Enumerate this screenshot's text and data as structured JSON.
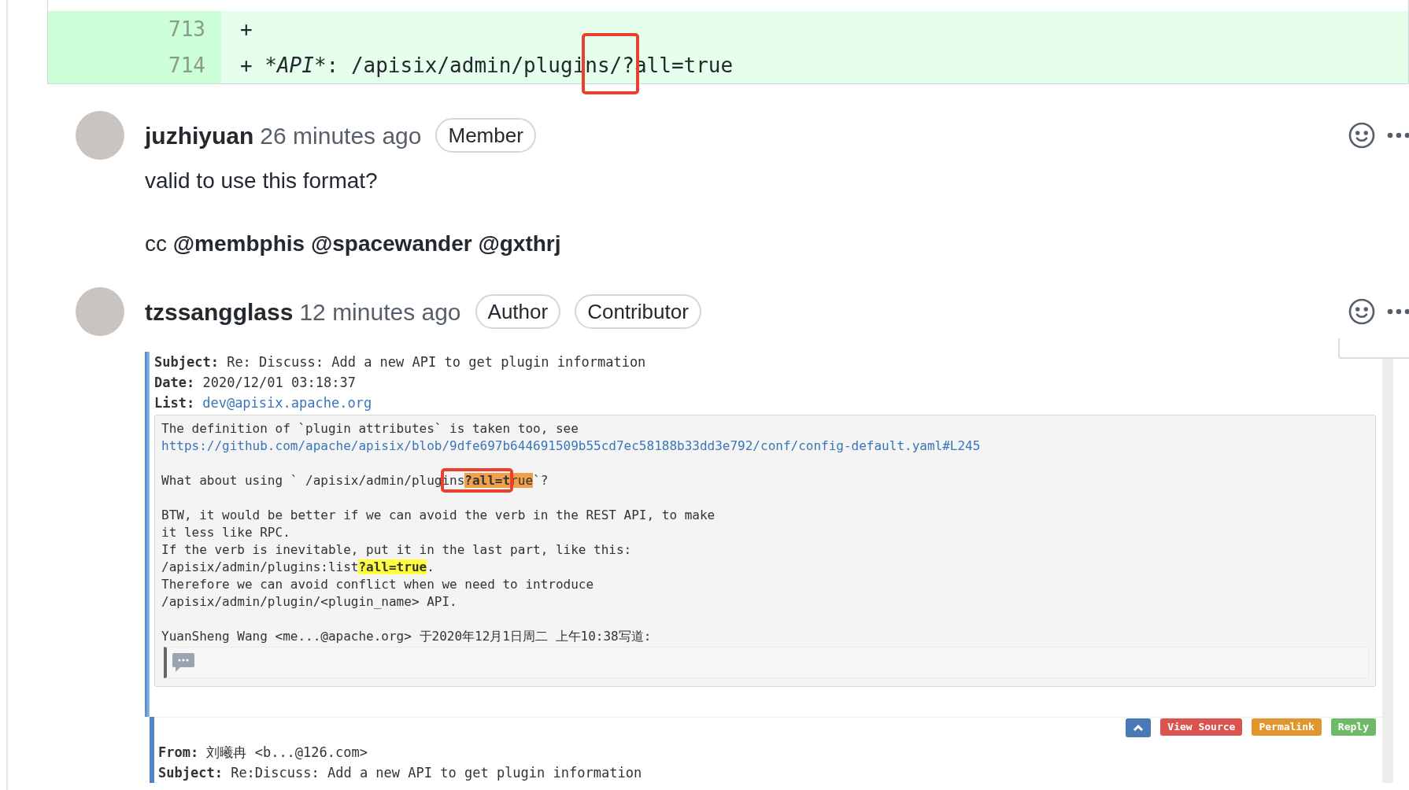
{
  "diff": {
    "lines": [
      {
        "number": "713",
        "kind": "added",
        "segments": [
          {
            "text": "+"
          }
        ]
      },
      {
        "number": "714",
        "kind": "added",
        "segments": [
          {
            "text": "+ *"
          },
          {
            "text": "API",
            "italic": true
          },
          {
            "text": "*: /apisix/admin/plugi"
          },
          {
            "text": "ns/?",
            "marked": true
          },
          {
            "text": "all=true"
          }
        ]
      }
    ]
  },
  "comments": [
    {
      "author": "juzhiyuan",
      "time": "26 minutes ago",
      "badges": [
        "Member"
      ],
      "paragraphs": [
        "valid to use this format?",
        "cc **@membphis** **@spacewander** **@gxthrj**"
      ]
    },
    {
      "author": "tzssangglass",
      "time": "12 minutes ago",
      "badges": [
        "Author",
        "Contributor"
      ],
      "email": {
        "headers": [
          {
            "label": "Subject:",
            "value": "Re: Discuss: Add a new API to get plugin information",
            "kind": "text"
          },
          {
            "label": "Date:",
            "value": "2020/12/01 03:18:37",
            "kind": "text"
          },
          {
            "label": "List:",
            "value": "dev@apisix.apache.org",
            "kind": "link"
          }
        ],
        "paragraphs": [
          [
            {
              "kind": "text",
              "segments": [
                {
                  "text": "The definition of `plugin attributes` is taken too, see"
                }
              ]
            },
            {
              "kind": "link",
              "segments": [
                {
                  "text": "https://github.com/apache/apisix/blob/9dfe697b644691509b55cd7ec58188b33dd3e792/conf/config-default.yaml#L245"
                }
              ]
            }
          ],
          [
            {
              "kind": "text",
              "segments": [
                {
                  "text": "What about using ` /apisix/admin/plug"
                },
                {
                  "text": "ins",
                  "marked": true
                },
                {
                  "text": "?all=t",
                  "marked": true,
                  "color": "#f0a04b",
                  "bold": true
                },
                {
                  "text": "rue",
                  "color": "#f0a04b"
                },
                {
                  "text": "`?"
                }
              ]
            }
          ],
          [
            {
              "kind": "text",
              "segments": [
                {
                  "text": "BTW, it would be better if we can avoid the verb in the REST API, to make"
                }
              ]
            },
            {
              "kind": "text",
              "segments": [
                {
                  "text": "it less like RPC."
                }
              ]
            },
            {
              "kind": "text",
              "segments": [
                {
                  "text": "If the verb is inevitable, put it in the last part, like this:"
                }
              ]
            },
            {
              "kind": "text",
              "segments": [
                {
                  "text": "/apisix/admin/plugins:list"
                },
                {
                  "text": "?all=true",
                  "color": "#ffff3c",
                  "bold": true
                },
                {
                  "text": "."
                }
              ]
            },
            {
              "kind": "text",
              "segments": [
                {
                  "text": "Therefore we can avoid conflict when we need to introduce"
                }
              ]
            },
            {
              "kind": "text",
              "segments": [
                {
                  "text": "/apisix/admin/plugin/<plugin_name> API."
                }
              ]
            }
          ],
          [
            {
              "kind": "text",
              "segments": [
                {
                  "text": "YuanSheng Wang <me...@apache.org> 于2020年12月1日周二 上午10:38写道:"
                }
              ]
            }
          ]
        ],
        "nested_quote_collapsed": true,
        "actions": [
          {
            "kind": "icon"
          },
          {
            "kind": "text",
            "label": "View Source",
            "color": "#d9534f"
          },
          {
            "kind": "text",
            "label": "Permalink",
            "color": "#e0952e"
          },
          {
            "kind": "text",
            "label": "Reply",
            "color": "#6fba68"
          }
        ],
        "next_message": [
          {
            "label": "From:",
            "value": "刘曦冉 <b...@126.com>",
            "kind": "text"
          },
          {
            "label": "Subject:",
            "value": "Re:Discuss: Add a new API to get plugin information",
            "kind": "text"
          }
        ]
      }
    }
  ]
}
